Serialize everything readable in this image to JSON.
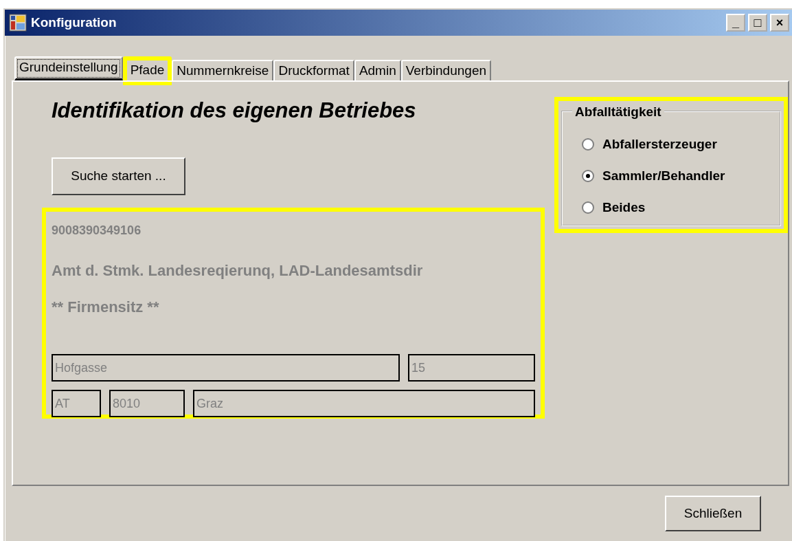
{
  "window": {
    "title": "Konfiguration",
    "controls": [
      "_",
      "□",
      "×"
    ]
  },
  "tabs": [
    {
      "label": "Grundeinstellung",
      "selected": true
    },
    {
      "label": "Pfade",
      "selected": false
    },
    {
      "label": "Nummernkreise",
      "selected": false
    },
    {
      "label": "Druckformat",
      "selected": false
    },
    {
      "label": "Admin",
      "selected": false
    },
    {
      "label": "Verbindungen",
      "selected": false
    }
  ],
  "heading": "Identifikation des eigenen Betriebes",
  "search_button": "Suche starten ...",
  "company": {
    "id": "9008390349106",
    "name": "Amt d. Stmk. Landesreqierunq, LAD-Landesamtsdir",
    "location": "** Firmensitz **",
    "street": "Hofgasse",
    "number": "15",
    "country": "AT",
    "zip": "8010",
    "city": "Graz"
  },
  "activity": {
    "title": "Abfalltätigkeit",
    "options": [
      {
        "label": "Abfallersterzeuger",
        "selected": false
      },
      {
        "label": "Sammler/Behandler",
        "selected": true
      },
      {
        "label": "Beides",
        "selected": false
      }
    ]
  },
  "close_button": "Schließen"
}
